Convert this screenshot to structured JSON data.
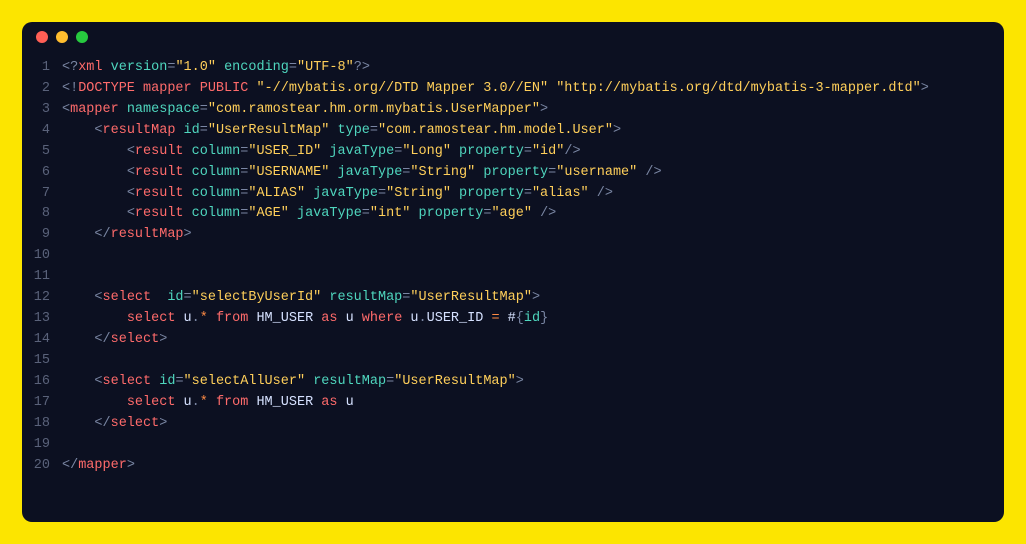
{
  "window": {
    "traffic_lights": [
      "red",
      "yellow",
      "green"
    ]
  },
  "code": {
    "lines": [
      {
        "n": 1,
        "spans": [
          {
            "c": "t-punc",
            "t": "<?"
          },
          {
            "c": "t-tag",
            "t": "xml"
          },
          {
            "c": "t-text",
            "t": " "
          },
          {
            "c": "t-attr",
            "t": "version"
          },
          {
            "c": "t-punc",
            "t": "="
          },
          {
            "c": "t-str",
            "t": "\"1.0\""
          },
          {
            "c": "t-text",
            "t": " "
          },
          {
            "c": "t-attr",
            "t": "encoding"
          },
          {
            "c": "t-punc",
            "t": "="
          },
          {
            "c": "t-str",
            "t": "\"UTF-8\""
          },
          {
            "c": "t-punc",
            "t": "?>"
          }
        ]
      },
      {
        "n": 2,
        "spans": [
          {
            "c": "t-punc",
            "t": "<!"
          },
          {
            "c": "t-tag",
            "t": "DOCTYPE mapper PUBLIC "
          },
          {
            "c": "t-str",
            "t": "\"-//mybatis.org//DTD Mapper 3.0//EN\""
          },
          {
            "c": "t-text",
            "t": " "
          },
          {
            "c": "t-str",
            "t": "\"http://mybatis.org/dtd/mybatis-3-mapper.dtd\""
          },
          {
            "c": "t-punc",
            "t": ">"
          }
        ]
      },
      {
        "n": 3,
        "spans": [
          {
            "c": "t-punc",
            "t": "<"
          },
          {
            "c": "t-tag",
            "t": "mapper"
          },
          {
            "c": "t-text",
            "t": " "
          },
          {
            "c": "t-attr",
            "t": "namespace"
          },
          {
            "c": "t-punc",
            "t": "="
          },
          {
            "c": "t-str",
            "t": "\"com.ramostear.hm.orm.mybatis.UserMapper\""
          },
          {
            "c": "t-punc",
            "t": ">"
          }
        ]
      },
      {
        "n": 4,
        "spans": [
          {
            "c": "t-text",
            "t": "    "
          },
          {
            "c": "t-punc",
            "t": "<"
          },
          {
            "c": "t-tag",
            "t": "resultMap"
          },
          {
            "c": "t-text",
            "t": " "
          },
          {
            "c": "t-attr",
            "t": "id"
          },
          {
            "c": "t-punc",
            "t": "="
          },
          {
            "c": "t-str",
            "t": "\"UserResultMap\""
          },
          {
            "c": "t-text",
            "t": " "
          },
          {
            "c": "t-attr",
            "t": "type"
          },
          {
            "c": "t-punc",
            "t": "="
          },
          {
            "c": "t-str",
            "t": "\"com.ramostear.hm.model.User\""
          },
          {
            "c": "t-punc",
            "t": ">"
          }
        ]
      },
      {
        "n": 5,
        "spans": [
          {
            "c": "t-text",
            "t": "        "
          },
          {
            "c": "t-punc",
            "t": "<"
          },
          {
            "c": "t-tag",
            "t": "result"
          },
          {
            "c": "t-text",
            "t": " "
          },
          {
            "c": "t-attr",
            "t": "column"
          },
          {
            "c": "t-punc",
            "t": "="
          },
          {
            "c": "t-str",
            "t": "\"USER_ID\""
          },
          {
            "c": "t-text",
            "t": " "
          },
          {
            "c": "t-attr",
            "t": "javaType"
          },
          {
            "c": "t-punc",
            "t": "="
          },
          {
            "c": "t-str",
            "t": "\"Long\""
          },
          {
            "c": "t-text",
            "t": " "
          },
          {
            "c": "t-attr",
            "t": "property"
          },
          {
            "c": "t-punc",
            "t": "="
          },
          {
            "c": "t-str",
            "t": "\"id\""
          },
          {
            "c": "t-punc",
            "t": "/>"
          }
        ]
      },
      {
        "n": 6,
        "spans": [
          {
            "c": "t-text",
            "t": "        "
          },
          {
            "c": "t-punc",
            "t": "<"
          },
          {
            "c": "t-tag",
            "t": "result"
          },
          {
            "c": "t-text",
            "t": " "
          },
          {
            "c": "t-attr",
            "t": "column"
          },
          {
            "c": "t-punc",
            "t": "="
          },
          {
            "c": "t-str",
            "t": "\"USERNAME\""
          },
          {
            "c": "t-text",
            "t": " "
          },
          {
            "c": "t-attr",
            "t": "javaType"
          },
          {
            "c": "t-punc",
            "t": "="
          },
          {
            "c": "t-str",
            "t": "\"String\""
          },
          {
            "c": "t-text",
            "t": " "
          },
          {
            "c": "t-attr",
            "t": "property"
          },
          {
            "c": "t-punc",
            "t": "="
          },
          {
            "c": "t-str",
            "t": "\"username\""
          },
          {
            "c": "t-text",
            "t": " "
          },
          {
            "c": "t-punc",
            "t": "/>"
          }
        ]
      },
      {
        "n": 7,
        "spans": [
          {
            "c": "t-text",
            "t": "        "
          },
          {
            "c": "t-punc",
            "t": "<"
          },
          {
            "c": "t-tag",
            "t": "result"
          },
          {
            "c": "t-text",
            "t": " "
          },
          {
            "c": "t-attr",
            "t": "column"
          },
          {
            "c": "t-punc",
            "t": "="
          },
          {
            "c": "t-str",
            "t": "\"ALIAS\""
          },
          {
            "c": "t-text",
            "t": " "
          },
          {
            "c": "t-attr",
            "t": "javaType"
          },
          {
            "c": "t-punc",
            "t": "="
          },
          {
            "c": "t-str",
            "t": "\"String\""
          },
          {
            "c": "t-text",
            "t": " "
          },
          {
            "c": "t-attr",
            "t": "property"
          },
          {
            "c": "t-punc",
            "t": "="
          },
          {
            "c": "t-str",
            "t": "\"alias\""
          },
          {
            "c": "t-text",
            "t": " "
          },
          {
            "c": "t-punc",
            "t": "/>"
          }
        ]
      },
      {
        "n": 8,
        "spans": [
          {
            "c": "t-text",
            "t": "        "
          },
          {
            "c": "t-punc",
            "t": "<"
          },
          {
            "c": "t-tag",
            "t": "result"
          },
          {
            "c": "t-text",
            "t": " "
          },
          {
            "c": "t-attr",
            "t": "column"
          },
          {
            "c": "t-punc",
            "t": "="
          },
          {
            "c": "t-str",
            "t": "\"AGE\""
          },
          {
            "c": "t-text",
            "t": " "
          },
          {
            "c": "t-attr",
            "t": "javaType"
          },
          {
            "c": "t-punc",
            "t": "="
          },
          {
            "c": "t-str",
            "t": "\"int\""
          },
          {
            "c": "t-text",
            "t": " "
          },
          {
            "c": "t-attr",
            "t": "property"
          },
          {
            "c": "t-punc",
            "t": "="
          },
          {
            "c": "t-str",
            "t": "\"age\""
          },
          {
            "c": "t-text",
            "t": " "
          },
          {
            "c": "t-punc",
            "t": "/>"
          }
        ]
      },
      {
        "n": 9,
        "spans": [
          {
            "c": "t-text",
            "t": "    "
          },
          {
            "c": "t-punc",
            "t": "</"
          },
          {
            "c": "t-tag",
            "t": "resultMap"
          },
          {
            "c": "t-punc",
            "t": ">"
          }
        ]
      },
      {
        "n": 10,
        "spans": [
          {
            "c": "t-text",
            "t": " "
          }
        ]
      },
      {
        "n": 11,
        "spans": [
          {
            "c": "t-text",
            "t": " "
          }
        ]
      },
      {
        "n": 12,
        "spans": [
          {
            "c": "t-text",
            "t": "    "
          },
          {
            "c": "t-punc",
            "t": "<"
          },
          {
            "c": "t-tag",
            "t": "select"
          },
          {
            "c": "t-text",
            "t": "  "
          },
          {
            "c": "t-attr",
            "t": "id"
          },
          {
            "c": "t-punc",
            "t": "="
          },
          {
            "c": "t-str",
            "t": "\"selectByUserId\""
          },
          {
            "c": "t-text",
            "t": " "
          },
          {
            "c": "t-attr",
            "t": "resultMap"
          },
          {
            "c": "t-punc",
            "t": "="
          },
          {
            "c": "t-str",
            "t": "\"UserResultMap\""
          },
          {
            "c": "t-punc",
            "t": ">"
          }
        ]
      },
      {
        "n": 13,
        "spans": [
          {
            "c": "t-text",
            "t": "        "
          },
          {
            "c": "t-tag",
            "t": "select"
          },
          {
            "c": "t-text",
            "t": " u"
          },
          {
            "c": "t-punc",
            "t": "."
          },
          {
            "c": "t-kw",
            "t": "*"
          },
          {
            "c": "t-text",
            "t": " "
          },
          {
            "c": "t-tag",
            "t": "from"
          },
          {
            "c": "t-text",
            "t": " HM_USER "
          },
          {
            "c": "t-tag",
            "t": "as"
          },
          {
            "c": "t-text",
            "t": " u "
          },
          {
            "c": "t-tag",
            "t": "where"
          },
          {
            "c": "t-text",
            "t": " u"
          },
          {
            "c": "t-punc",
            "t": "."
          },
          {
            "c": "t-text",
            "t": "USER_ID "
          },
          {
            "c": "t-kw",
            "t": "="
          },
          {
            "c": "t-text",
            "t": " #"
          },
          {
            "c": "t-punc",
            "t": "{"
          },
          {
            "c": "t-attr",
            "t": "id"
          },
          {
            "c": "t-punc",
            "t": "}"
          }
        ]
      },
      {
        "n": 14,
        "spans": [
          {
            "c": "t-text",
            "t": "    "
          },
          {
            "c": "t-punc",
            "t": "</"
          },
          {
            "c": "t-tag",
            "t": "select"
          },
          {
            "c": "t-punc",
            "t": ">"
          }
        ]
      },
      {
        "n": 15,
        "spans": [
          {
            "c": "t-text",
            "t": " "
          }
        ]
      },
      {
        "n": 16,
        "spans": [
          {
            "c": "t-text",
            "t": "    "
          },
          {
            "c": "t-punc",
            "t": "<"
          },
          {
            "c": "t-tag",
            "t": "select"
          },
          {
            "c": "t-text",
            "t": " "
          },
          {
            "c": "t-attr",
            "t": "id"
          },
          {
            "c": "t-punc",
            "t": "="
          },
          {
            "c": "t-str",
            "t": "\"selectAllUser\""
          },
          {
            "c": "t-text",
            "t": " "
          },
          {
            "c": "t-attr",
            "t": "resultMap"
          },
          {
            "c": "t-punc",
            "t": "="
          },
          {
            "c": "t-str",
            "t": "\"UserResultMap\""
          },
          {
            "c": "t-punc",
            "t": ">"
          }
        ]
      },
      {
        "n": 17,
        "spans": [
          {
            "c": "t-text",
            "t": "        "
          },
          {
            "c": "t-tag",
            "t": "select"
          },
          {
            "c": "t-text",
            "t": " u"
          },
          {
            "c": "t-punc",
            "t": "."
          },
          {
            "c": "t-kw",
            "t": "*"
          },
          {
            "c": "t-text",
            "t": " "
          },
          {
            "c": "t-tag",
            "t": "from"
          },
          {
            "c": "t-text",
            "t": " HM_USER "
          },
          {
            "c": "t-tag",
            "t": "as"
          },
          {
            "c": "t-text",
            "t": " u"
          }
        ]
      },
      {
        "n": 18,
        "spans": [
          {
            "c": "t-text",
            "t": "    "
          },
          {
            "c": "t-punc",
            "t": "</"
          },
          {
            "c": "t-tag",
            "t": "select"
          },
          {
            "c": "t-punc",
            "t": ">"
          }
        ]
      },
      {
        "n": 19,
        "spans": [
          {
            "c": "t-text",
            "t": " "
          }
        ]
      },
      {
        "n": 20,
        "spans": [
          {
            "c": "t-punc",
            "t": "</"
          },
          {
            "c": "t-tag",
            "t": "mapper"
          },
          {
            "c": "t-punc",
            "t": ">"
          }
        ]
      }
    ]
  }
}
